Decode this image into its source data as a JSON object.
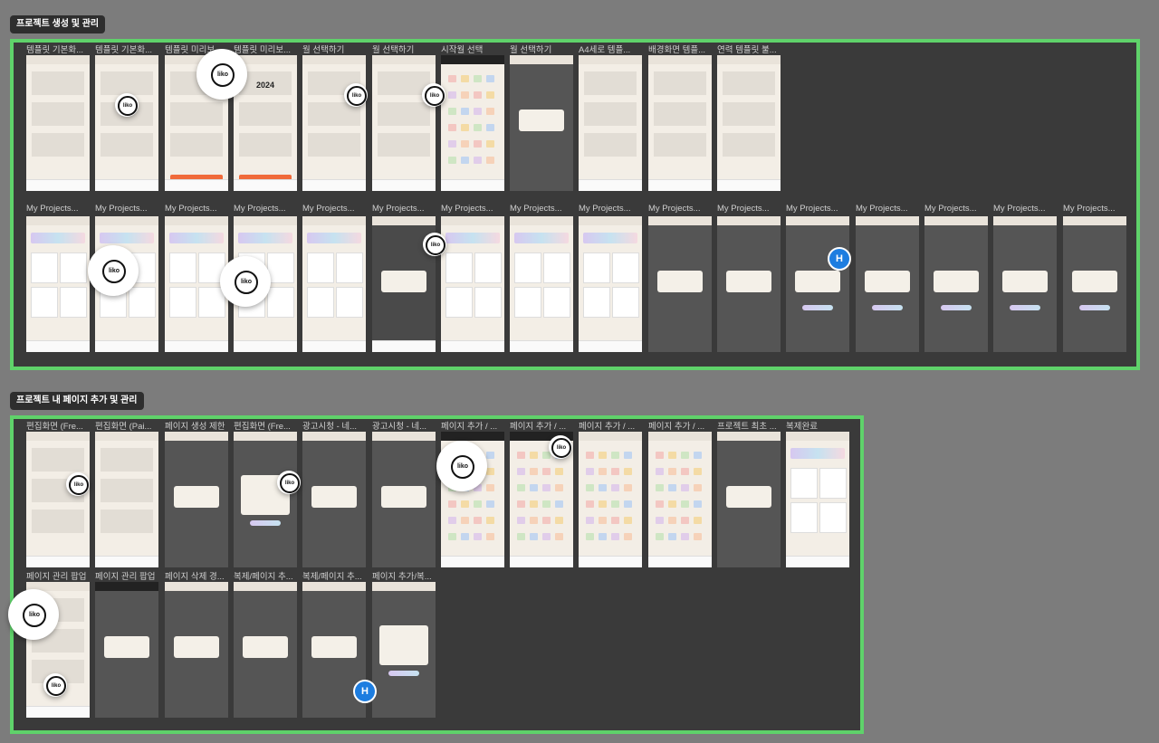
{
  "sections": [
    {
      "label": "프로젝트 생성 및 관리"
    },
    {
      "label": "프로젝트 내 페이지 추가 및 관리"
    }
  ],
  "rows": {
    "s1r1": [
      "템플릿 기본화...",
      "템플릿 기본화...",
      "템플릿 미리보...",
      "템플릿 미리보...",
      "월 선택하기",
      "월 선택하기",
      "시작월 선택",
      "월 선택하기",
      "A4세로 템플...",
      "배경화면 템플...",
      "연력 템플릿 불..."
    ],
    "s1r2": [
      "My Projects...",
      "My Projects...",
      "My Projects...",
      "My Projects...",
      "My Projects...",
      "My Projects...",
      "My Projects...",
      "My Projects...",
      "My Projects...",
      "My Projects...",
      "My Projects...",
      "My Projects...",
      "My Projects...",
      "My Projects...",
      "My Projects...",
      "My Projects..."
    ],
    "s2r1": [
      "편집화면 (Fre...",
      "편집화면 (Pai...",
      "페이지 생성 제한",
      "편집화면 (Fre...",
      "광고시청 - 네...",
      "광고시청 - 네...",
      "페이지 추가 / ...",
      "페이지 추가 / ...",
      "페이지 추가 / ...",
      "페이지 추가 / ...",
      "프로젝트 최초 ...",
      "복제완료"
    ],
    "s2r2": [
      "페이지 관리 팝업",
      "페이지 관리 팝업",
      "페이지 삭제 경...",
      "복제/페이지 추...",
      "복제/페이지 추...",
      "페이지 추가/복..."
    ]
  },
  "screen_text": {
    "year": "2024"
  },
  "badge_text": "liko",
  "avatar_initial": "H",
  "colors": {
    "section_border": "#5fd26a",
    "canvas": "#7c7c7c",
    "section_bg": "#3a3a3a",
    "accent_orange": "#f06a3a",
    "avatar_blue": "#1d7de0"
  }
}
